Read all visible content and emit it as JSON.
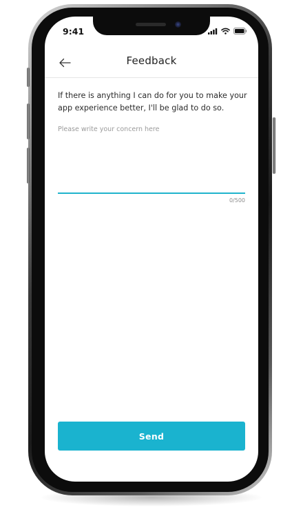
{
  "status_bar": {
    "time": "9:41",
    "icons": [
      "signal-icon",
      "wifi-icon",
      "battery-icon"
    ]
  },
  "header": {
    "title": "Feedback",
    "back_icon": "arrow-left-icon"
  },
  "content": {
    "intro_text": "If there is anything I can do for you to make your app experience better, I'll be glad to do so.",
    "concern_placeholder": "Please write your concern here",
    "concern_value": "",
    "char_counter": "0/500"
  },
  "footer": {
    "send_label": "Send"
  },
  "colors": {
    "accent": "#1ab3cf",
    "underline": "#1fb3cc",
    "text": "#2b2b2b",
    "placeholder": "#9a9a9a"
  }
}
